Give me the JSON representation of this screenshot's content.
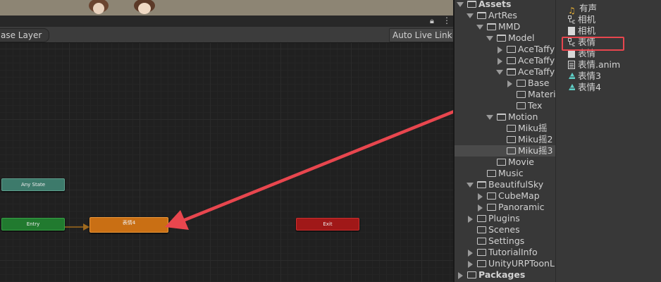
{
  "animator": {
    "layer_tab": "ase Layer",
    "auto_live_link": "Auto Live Link",
    "nodes": {
      "any_state": "Any State",
      "entry": "Entry",
      "state": "表情4",
      "exit": "Exit"
    }
  },
  "project_tree": {
    "items": [
      {
        "label": "Assets"
      },
      {
        "label": "ArtRes"
      },
      {
        "label": "MMD"
      },
      {
        "label": "Model"
      },
      {
        "label": "AceTaffy"
      },
      {
        "label": "AceTaffy"
      },
      {
        "label": "AceTaffy"
      },
      {
        "label": "Base"
      },
      {
        "label": "Materi"
      },
      {
        "label": "Tex"
      },
      {
        "label": "Motion"
      },
      {
        "label": "Miku摇"
      },
      {
        "label": "Miku摇2"
      },
      {
        "label": "Miku摇3"
      },
      {
        "label": "Movie"
      },
      {
        "label": "Music"
      },
      {
        "label": "BeautifulSky"
      },
      {
        "label": "CubeMap"
      },
      {
        "label": "Panoramic"
      },
      {
        "label": "Plugins"
      },
      {
        "label": "Scenes"
      },
      {
        "label": "Settings"
      },
      {
        "label": "TutorialInfo"
      },
      {
        "label": "UnityURPToonLi"
      },
      {
        "label": "Packages"
      }
    ]
  },
  "asset_list": {
    "items": [
      {
        "label": "有声",
        "icon": "audio-icon"
      },
      {
        "label": "相机",
        "icon": "animator-controller-icon"
      },
      {
        "label": "相机",
        "icon": "file-icon"
      },
      {
        "label": "表情",
        "icon": "animator-controller-icon"
      },
      {
        "label": "表情",
        "icon": "file-icon"
      },
      {
        "label": "表情.anim",
        "icon": "text-file-icon"
      },
      {
        "label": "表情3",
        "icon": "animation-clip-icon"
      },
      {
        "label": "表情4",
        "icon": "animation-clip-icon"
      }
    ]
  },
  "colors": {
    "any_state": "#3d7a6b",
    "entry": "#217a2f",
    "state": "#c96f14",
    "exit": "#a01818",
    "annotation": "#e8464e"
  }
}
